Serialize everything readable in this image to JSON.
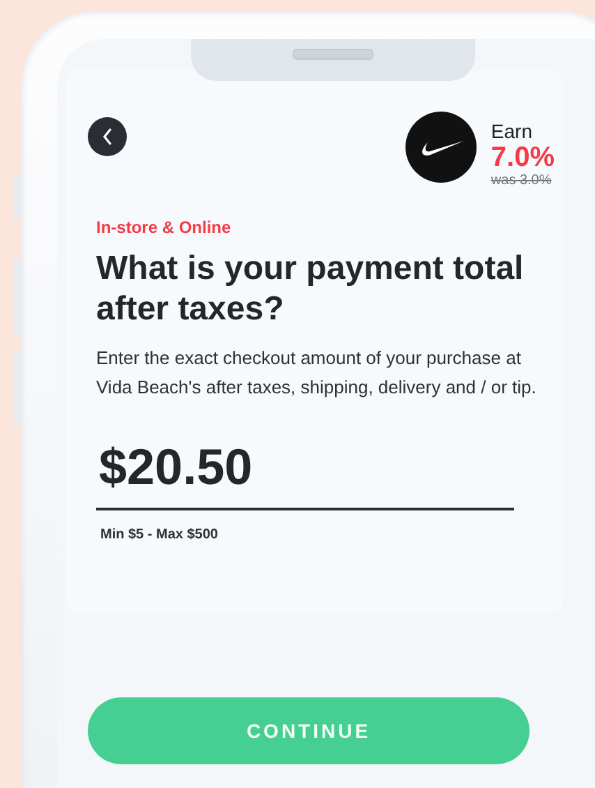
{
  "merchant": {
    "earn_label": "Earn",
    "rate": "7.0%",
    "previous_rate": "was 3.0%"
  },
  "channel_label": "In-store & Online",
  "title": "What is your payment total after taxes?",
  "description": "Enter the exact checkout amount of your purchase at Vida Beach's after taxes, shipping, delivery and / or tip.",
  "amount_field": {
    "value": "$20.50"
  },
  "range_hint": "Min $5 - Max $500",
  "button": {
    "label": "CONTINUE"
  }
}
